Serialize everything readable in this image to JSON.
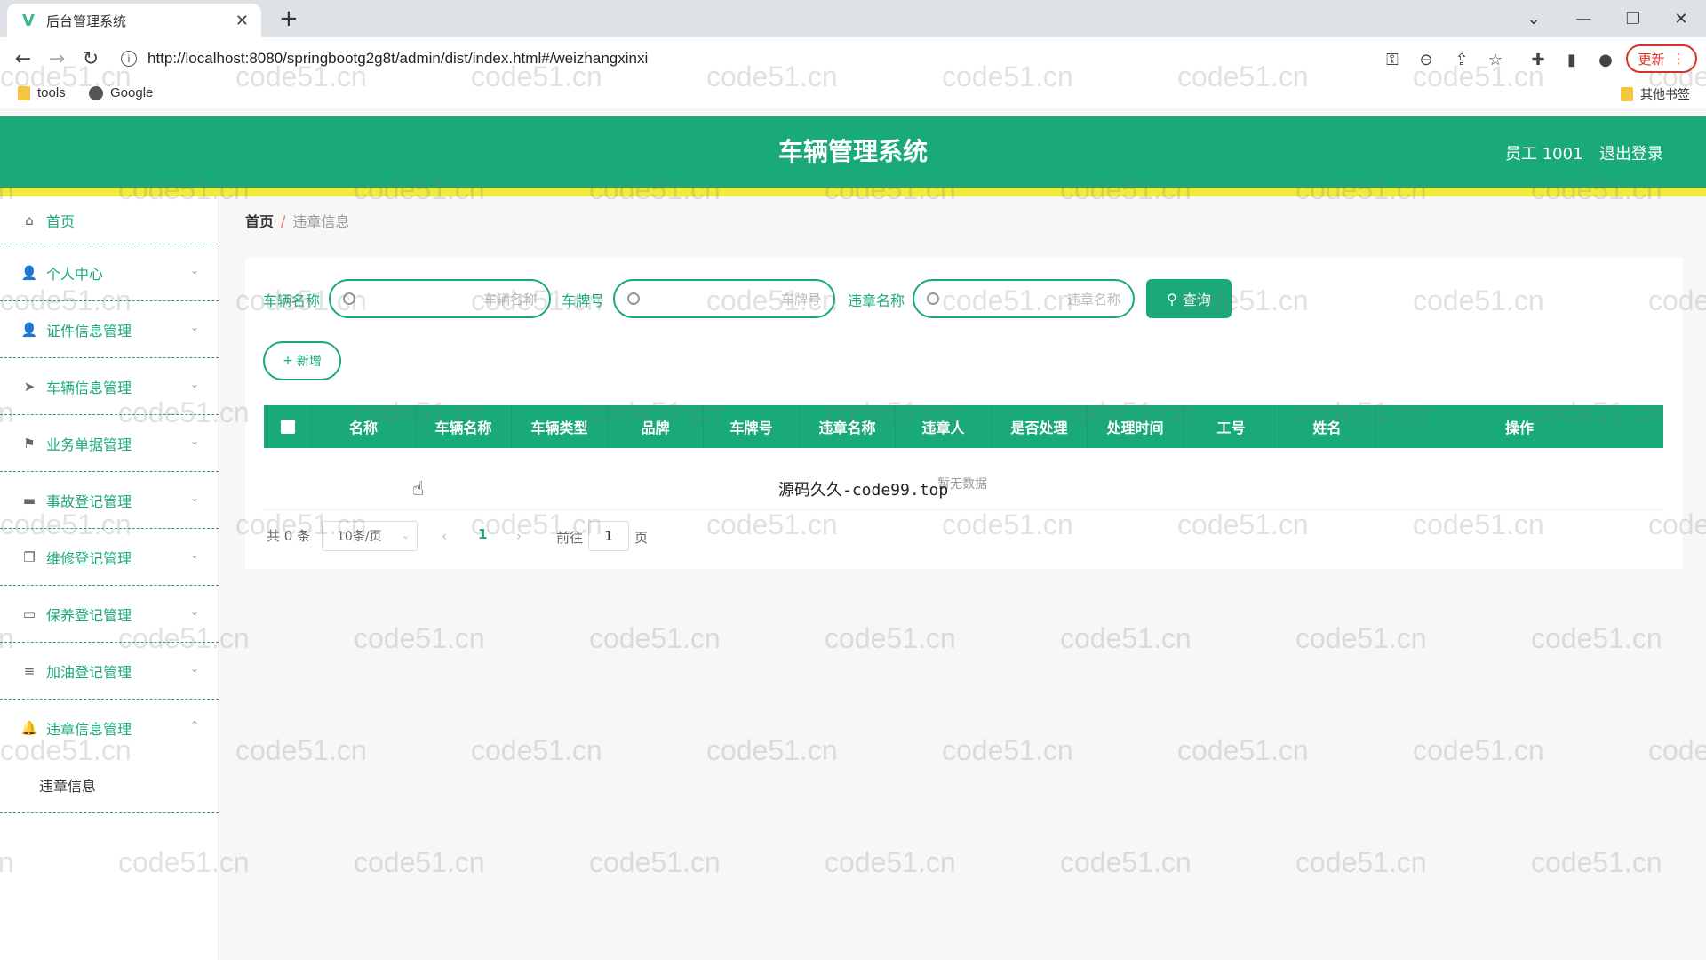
{
  "browser": {
    "tab_title": "后台管理系统",
    "url": "http://localhost:8080/springbootg2g8t/admin/dist/index.html#/weizhangxinxi",
    "update_label": "更新",
    "bookmarks": [
      {
        "label": "tools",
        "icon": "folder-icon"
      },
      {
        "label": "Google",
        "icon": "globe-icon"
      }
    ],
    "other_bookmarks": "其他书签"
  },
  "header": {
    "title": "车辆管理系统",
    "user": "员工 1001",
    "logout": "退出登录"
  },
  "sidebar": {
    "items": [
      {
        "label": "首页",
        "icon": "home-icon"
      },
      {
        "label": "个人中心",
        "icon": "user-icon"
      },
      {
        "label": "证件信息管理",
        "icon": "user-icon"
      },
      {
        "label": "车辆信息管理",
        "icon": "send-icon"
      },
      {
        "label": "业务单据管理",
        "icon": "flag-icon"
      },
      {
        "label": "事故登记管理",
        "icon": "car-icon"
      },
      {
        "label": "维修登记管理",
        "icon": "copy-icon"
      },
      {
        "label": "保养登记管理",
        "icon": "comment-icon"
      },
      {
        "label": "加油登记管理",
        "icon": "menu-icon"
      },
      {
        "label": "违章信息管理",
        "icon": "bell-icon"
      }
    ],
    "sub_item": "违章信息"
  },
  "breadcrumb": {
    "home": "首页",
    "separator": "/",
    "current": "违章信息"
  },
  "filters": {
    "vehicle_name_label": "车辆名称",
    "vehicle_name_placeholder": "车辆名称",
    "plate_label": "车牌号",
    "plate_placeholder": "车牌号",
    "violation_label": "违章名称",
    "violation_placeholder": "违章名称",
    "query_button": "查询",
    "add_button": "新增"
  },
  "table": {
    "columns": [
      "名称",
      "车辆名称",
      "车辆类型",
      "品牌",
      "车牌号",
      "违章名称",
      "违章人",
      "是否处理",
      "处理时间",
      "工号",
      "姓名",
      "操作"
    ],
    "empty_text": "暂无数据",
    "overlay_text": "源码久久-code99.top"
  },
  "pagination": {
    "total": "共 0 条",
    "page_size": "10条/页",
    "current_page": "1",
    "goto_label": "前往",
    "goto_value": "1",
    "page_suffix": "页"
  },
  "watermark": "code51.cn",
  "colors": {
    "primary": "#19a97b",
    "header_strip": "#eeee3a"
  }
}
